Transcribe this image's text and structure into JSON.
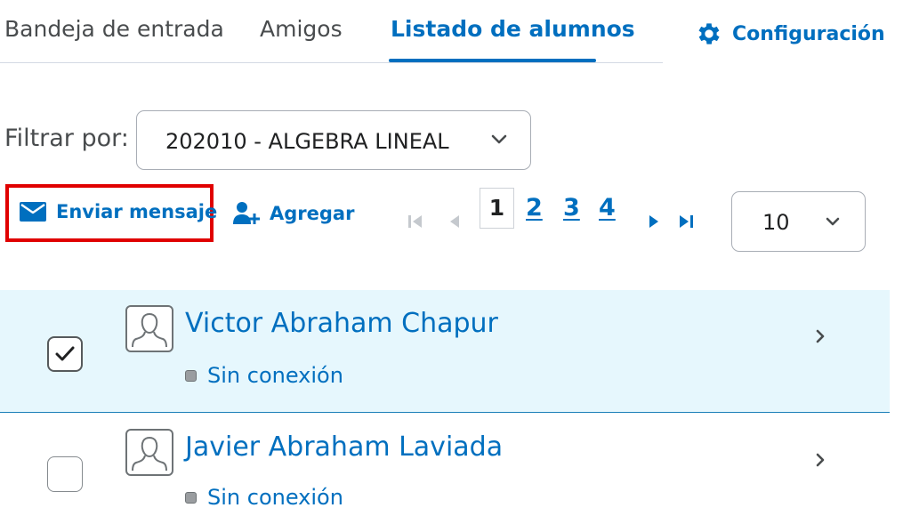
{
  "tabs": [
    {
      "label": "Bandeja de entrada"
    },
    {
      "label": "Amigos"
    },
    {
      "label": "Listado de alumnos",
      "active": true
    }
  ],
  "settings_label": "Configuración",
  "filter": {
    "label": "Filtrar por:",
    "value": "202010 - ALGEBRA LINEAL"
  },
  "actions": {
    "send_message": "Enviar mensaje",
    "add": "Agregar"
  },
  "pagination": {
    "current": "1",
    "pages": [
      "2",
      "3",
      "4"
    ],
    "per_page": "10"
  },
  "students": [
    {
      "name": "Victor Abraham Chapur",
      "status": "Sin conexión",
      "checked": true
    },
    {
      "name": "Javier Abraham Laviada",
      "status": "Sin conexión",
      "checked": false
    }
  ],
  "colors": {
    "accent": "#006fbf",
    "highlight_border": "#e00000",
    "selected_row": "#e6f7fd"
  },
  "icons": [
    "gear-icon",
    "envelope-icon",
    "add-user-icon",
    "first-page-icon",
    "prev-page-icon",
    "next-page-icon",
    "last-page-icon",
    "chevron-down-icon",
    "checkmark-icon",
    "user-avatar-icon",
    "chevron-right-icon",
    "status-offline-icon"
  ]
}
